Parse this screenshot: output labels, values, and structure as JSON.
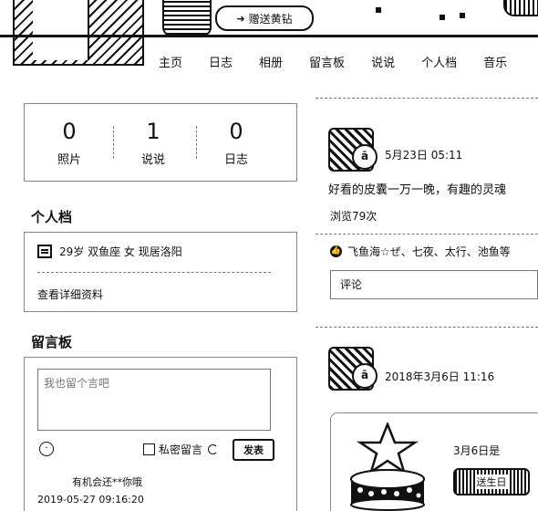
{
  "header": {
    "gift_button": "赠送黄钻",
    "nav": [
      "主页",
      "日志",
      "相册",
      "留言板",
      "说说",
      "个人档",
      "音乐"
    ]
  },
  "stats": [
    {
      "value": "0",
      "label": "照片"
    },
    {
      "value": "1",
      "label": "说说"
    },
    {
      "value": "0",
      "label": "日志"
    }
  ],
  "profile": {
    "title": "个人档",
    "summary": "29岁  双鱼座 女 现居洛阳",
    "more_link": "查看详细资料"
  },
  "guestbook": {
    "title": "留言板",
    "placeholder": "我也留个言吧",
    "private_label": "私密留言",
    "post_button": "发表",
    "last_author_text": "有机会还**你哦",
    "last_time": "2019-05-27 09:16:20"
  },
  "feed": [
    {
      "time": "5月23日 05:11",
      "text": "好看的皮囊一万一晚，有趣的灵魂",
      "views": "浏览79次",
      "likes": "飞鱼海☆ぜ、七夜、太行、池鱼等",
      "comment_placeholder": "评论"
    },
    {
      "time": "2018年3月6日 11:16",
      "share_date": "3月6日是",
      "send_button": "送生日"
    }
  ],
  "icons": {
    "stats": "document-icon",
    "like": "thumbs-up-icon",
    "emoji": "smiley-icon"
  }
}
